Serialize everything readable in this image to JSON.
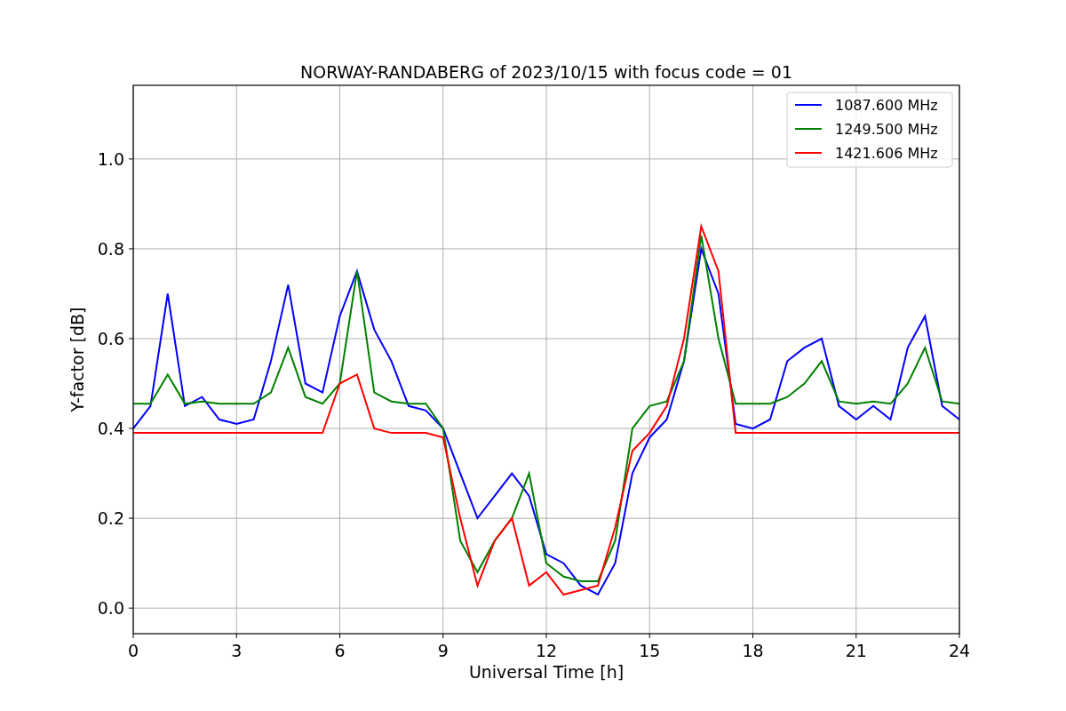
{
  "chart_data": {
    "type": "line",
    "title": "NORWAY-RANDABERG of 2023/10/15 with focus code = 01",
    "xlabel": "Universal Time [h]",
    "ylabel": "Y-factor [dB]",
    "x": [
      0,
      0.5,
      1,
      1.5,
      2,
      2.5,
      3,
      3.5,
      4,
      4.5,
      5,
      5.5,
      6,
      6.5,
      7,
      7.5,
      8,
      8.5,
      9,
      9.5,
      10,
      10.5,
      11,
      11.5,
      12,
      12.5,
      13,
      13.5,
      14,
      14.5,
      15,
      15.5,
      16,
      16.5,
      17,
      17.5,
      18,
      18.5,
      19,
      19.5,
      20,
      20.5,
      21,
      21.5,
      22,
      22.5,
      23,
      23.5,
      24
    ],
    "series": [
      {
        "name": "1087.600 MHz",
        "color": "#0000ff",
        "values": [
          0.4,
          0.45,
          0.7,
          0.45,
          0.47,
          0.42,
          0.41,
          0.42,
          0.55,
          0.72,
          0.5,
          0.48,
          0.65,
          0.75,
          0.62,
          0.55,
          0.45,
          0.44,
          0.4,
          0.3,
          0.2,
          0.25,
          0.3,
          0.25,
          0.12,
          0.1,
          0.05,
          0.03,
          0.1,
          0.3,
          0.38,
          0.42,
          0.55,
          0.8,
          0.7,
          0.41,
          0.4,
          0.42,
          0.55,
          0.58,
          0.6,
          0.45,
          0.42,
          0.45,
          0.42,
          0.58,
          0.65,
          0.45,
          0.42
        ]
      },
      {
        "name": "1249.500 MHz",
        "color": "#008000",
        "values": [
          0.455,
          0.455,
          0.52,
          0.455,
          0.46,
          0.455,
          0.455,
          0.455,
          0.48,
          0.58,
          0.47,
          0.455,
          0.5,
          0.75,
          0.48,
          0.46,
          0.455,
          0.455,
          0.4,
          0.15,
          0.08,
          0.15,
          0.2,
          0.3,
          0.1,
          0.07,
          0.06,
          0.06,
          0.15,
          0.4,
          0.45,
          0.46,
          0.55,
          0.83,
          0.6,
          0.455,
          0.455,
          0.455,
          0.47,
          0.5,
          0.55,
          0.46,
          0.455,
          0.46,
          0.455,
          0.5,
          0.58,
          0.46,
          0.455
        ]
      },
      {
        "name": "1421.606 MHz",
        "color": "#ff0000",
        "values": [
          0.39,
          0.39,
          0.39,
          0.39,
          0.39,
          0.39,
          0.39,
          0.39,
          0.39,
          0.39,
          0.39,
          0.39,
          0.5,
          0.52,
          0.4,
          0.39,
          0.39,
          0.39,
          0.38,
          0.2,
          0.05,
          0.15,
          0.2,
          0.05,
          0.08,
          0.03,
          0.04,
          0.05,
          0.18,
          0.35,
          0.39,
          0.45,
          0.6,
          0.85,
          0.75,
          0.39,
          0.39,
          0.39,
          0.39,
          0.39,
          0.39,
          0.39,
          0.39,
          0.39,
          0.39,
          0.39,
          0.39,
          0.39,
          0.39
        ]
      }
    ],
    "grid": true,
    "legend": true,
    "xlim": [
      0,
      24
    ],
    "ylim": [
      -0.057,
      1.164
    ],
    "xticks": [
      0,
      3,
      6,
      9,
      12,
      15,
      18,
      21,
      24
    ],
    "yticks": [
      {
        "value": 0,
        "label": "0.0"
      },
      {
        "value": 0.2,
        "label": "0.2"
      },
      {
        "value": 0.4,
        "label": "0.4"
      },
      {
        "value": 0.6,
        "label": "0.6"
      },
      {
        "value": 0.8,
        "label": "0.8"
      },
      {
        "value": 1,
        "label": "1.0"
      }
    ]
  }
}
